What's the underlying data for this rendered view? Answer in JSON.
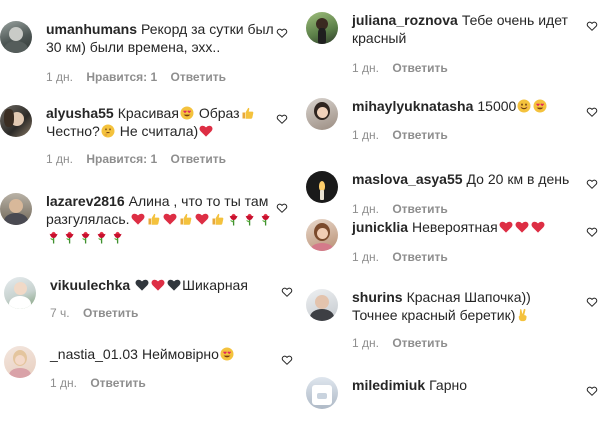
{
  "comments_left": [
    {
      "username": "umanhumans",
      "text": "Рекорд за сутки был 30 км) были времена, эхх..",
      "time": "1 дн.",
      "likes": "Нравится: 1",
      "reply": "Ответить"
    },
    {
      "username": "alyusha55",
      "text_1": "Красивая",
      "text_2": "Образ",
      "text_3": "Честно?",
      "text_4": "Не считала)",
      "time": "1 дн.",
      "likes": "Нравится: 1",
      "reply": "Ответить"
    },
    {
      "username": "lazarev2816",
      "text": "Алина , что то ты там разгулялась.",
      "time": "1 дн.",
      "likes": "Нравится: 1",
      "reply": "Ответить"
    },
    {
      "username": "vikuulechka",
      "text": "Шикарная",
      "time": "7 ч.",
      "reply": "Ответить"
    },
    {
      "username": "_nastia_01.03",
      "text": "Неймовірно",
      "time": "1 дн.",
      "reply": "Ответить"
    }
  ],
  "comments_right": [
    {
      "username": "juliana_roznova",
      "text": "Тебе очень идет красный",
      "time": "1 дн.",
      "reply": "Ответить"
    },
    {
      "username": "mihaylyuknatasha",
      "text": "15000",
      "time": "1 дн.",
      "reply": "Ответить"
    },
    {
      "username": "maslova_asya55",
      "text": "До 20 км в день",
      "time": "1 дн.",
      "reply": "Ответить"
    },
    {
      "username": "junicklia",
      "text": "Невероятная",
      "time": "1 дн.",
      "reply": "Ответить"
    },
    {
      "username": "shurins",
      "text_1": "Красная Шапочка))",
      "text_2": "Точнее красный беретик)",
      "time": "1 дн.",
      "reply": "Ответить"
    },
    {
      "username": "miledimiuk",
      "text": "Гарно"
    }
  ],
  "icons": {
    "like": "heart-outline-icon",
    "emoji_kinds": [
      "heart-eyes-emoji",
      "thumbs-up-emoji",
      "thinking-emoji",
      "red-heart-emoji",
      "black-heart-emoji",
      "rose-emoji",
      "smiling-emoji",
      "victory-hand-emoji"
    ]
  },
  "colors": {
    "text": "#262626",
    "meta": "#8e8e8e",
    "heart": "#ed4956"
  }
}
